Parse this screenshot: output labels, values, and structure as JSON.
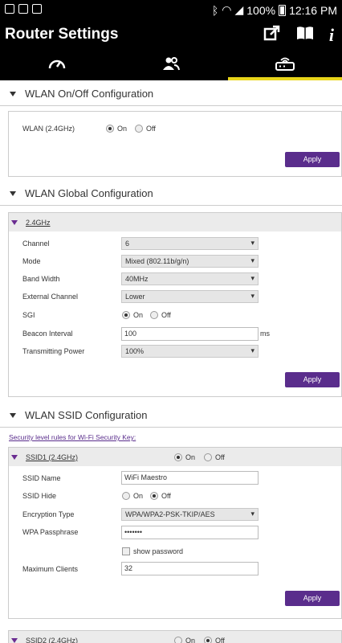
{
  "status": {
    "battery": "100%",
    "time": "12:16 PM"
  },
  "header": {
    "title": "Router Settings"
  },
  "tabs": [
    "speedometer",
    "users",
    "router"
  ],
  "wlan_onoff": {
    "title": "WLAN On/Off Configuration",
    "label": "WLAN (2.4GHz)",
    "on_label": "On",
    "off_label": "Off",
    "selected": "On",
    "apply": "Apply"
  },
  "wlan_global": {
    "title": "WLAN Global Configuration",
    "band_link": "2.4GHz",
    "channel_label": "Channel",
    "channel_value": "6",
    "mode_label": "Mode",
    "mode_value": "Mixed (802.11b/g/n)",
    "bandwidth_label": "Band Width",
    "bandwidth_value": "40MHz",
    "ext_channel_label": "External Channel",
    "ext_channel_value": "Lower",
    "sgi_label": "SGI",
    "on_label": "On",
    "off_label": "Off",
    "beacon_label": "Beacon Interval",
    "beacon_value": "100",
    "beacon_unit": "ms",
    "power_label": "Transmitting Power",
    "power_value": "100%",
    "apply": "Apply"
  },
  "wlan_ssid": {
    "title": "WLAN SSID Configuration",
    "security_link": "Security level rules for Wi-Fi Security Key:",
    "ssid1": {
      "header": "SSID1 (2.4GHz)",
      "on_label": "On",
      "off_label": "Off",
      "name_label": "SSID Name",
      "name_value": "WiFi Maestro",
      "hide_label": "SSID Hide",
      "enc_label": "Encryption Type",
      "enc_value": "WPA/WPA2-PSK-TKIP/AES",
      "pass_label": "WPA Passphrase",
      "pass_value": "•••••••",
      "show_password": "show password",
      "max_label": "Maximum Clients",
      "max_value": "32",
      "apply": "Apply"
    },
    "ssid2": {
      "header": "SSID2 (2.4GHz)",
      "on_label": "On",
      "off_label": "Off"
    }
  }
}
